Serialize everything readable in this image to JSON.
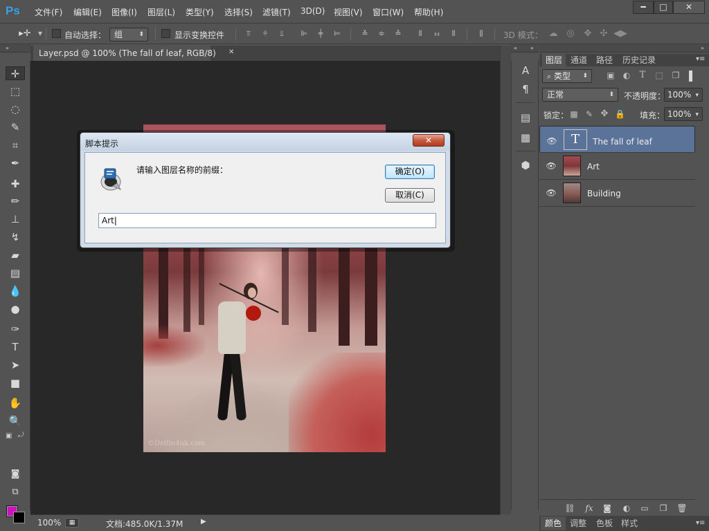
{
  "app": {
    "logo": "Ps"
  },
  "menu": [
    "文件(F)",
    "编辑(E)",
    "图像(I)",
    "图层(L)",
    "类型(Y)",
    "选择(S)",
    "滤镜(T)",
    "3D(D)",
    "视图(V)",
    "窗口(W)",
    "帮助(H)"
  ],
  "window_buttons": {
    "minimize": "━",
    "maximize": "□",
    "close": "✕"
  },
  "options": {
    "auto_select_label": "自动选择：",
    "auto_select_value": "组",
    "show_transform_label": "显示变换控件",
    "mode_3d_label": "3D 模式："
  },
  "document": {
    "tab_title": "Layer.psd @ 100% (The fall of leaf, RGB/8)",
    "tab_close": "✕",
    "watermark": "©Delfin4uk.com"
  },
  "dialog": {
    "title": "脚本提示",
    "close": "✕",
    "prompt": "请输入图层名称的前缀：",
    "ok_label": "确定(O)",
    "cancel_label": "取消(C)",
    "input_value": "Art"
  },
  "layers_panel": {
    "tabs": [
      "图层",
      "通道",
      "路径",
      "历史记录"
    ],
    "filter_label": "类型",
    "blend_mode": "正常",
    "opacity_label": "不透明度：",
    "opacity_value": "100%",
    "lock_label": "锁定：",
    "fill_label": "填充：",
    "fill_value": "100%",
    "layers": [
      {
        "name": "The fall of leaf",
        "type": "text",
        "selected": true
      },
      {
        "name": "Art",
        "type": "image",
        "selected": false
      },
      {
        "name": "Building",
        "type": "image",
        "selected": false
      }
    ]
  },
  "status": {
    "zoom": "100%",
    "doc_info": "文档:485.0K/1.37M"
  },
  "bottom_tabs": [
    "颜色",
    "调整",
    "色板",
    "样式"
  ],
  "colors": {
    "foreground": "#d010c0",
    "background": "#000000",
    "selected_layer": "#5c7399",
    "ui_bg": "#535353"
  }
}
